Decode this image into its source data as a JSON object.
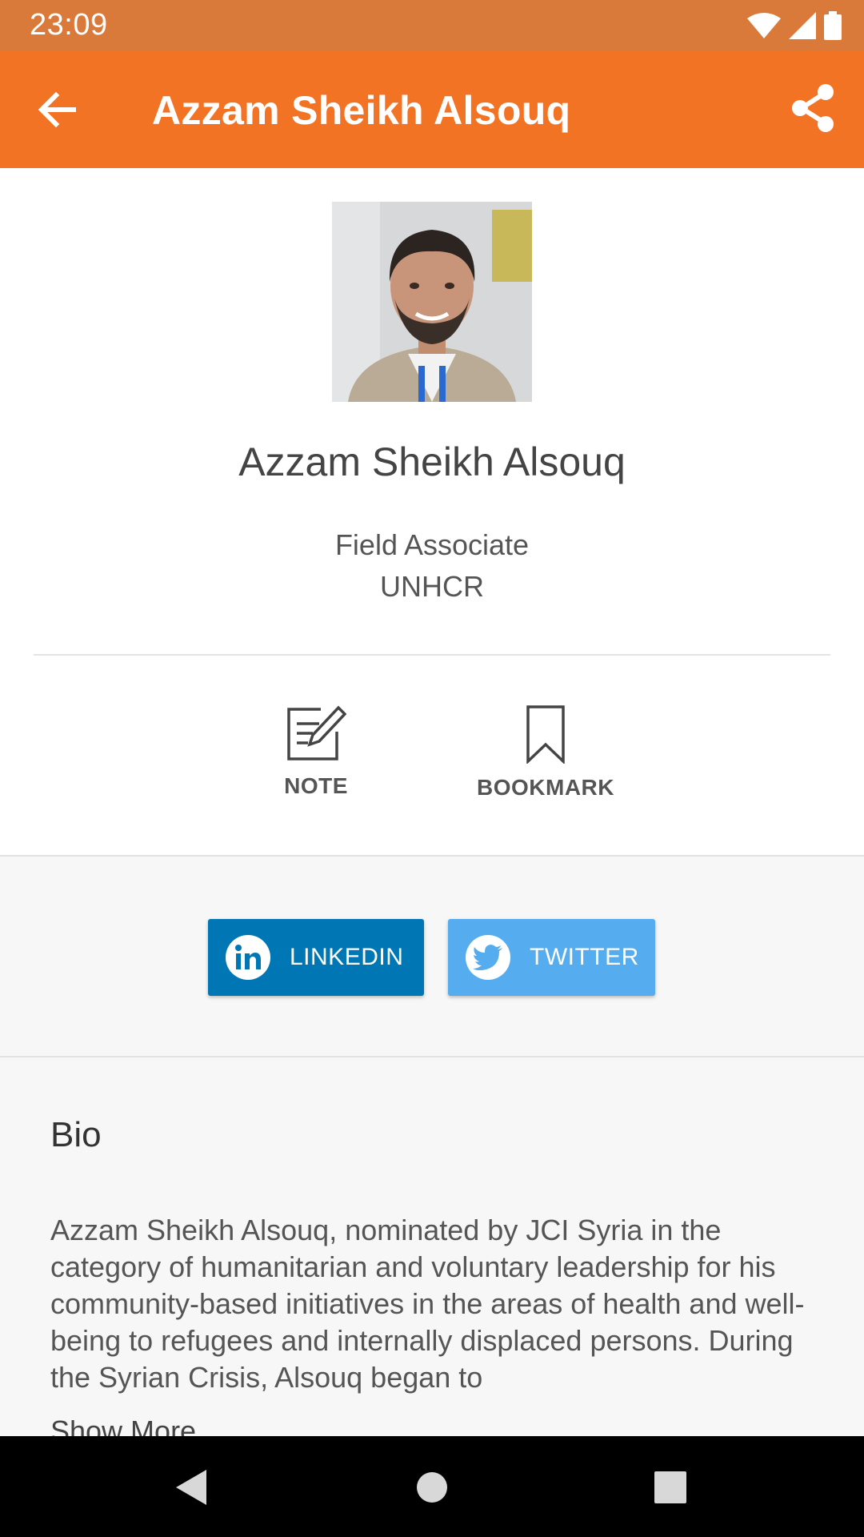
{
  "status_bar": {
    "time": "23:09"
  },
  "app_bar": {
    "title": "Azzam Sheikh Alsouq"
  },
  "profile": {
    "name": "Azzam Sheikh Alsouq",
    "job_title": "Field Associate",
    "organization": "UNHCR"
  },
  "actions": {
    "note_label": "NOTE",
    "bookmark_label": "BOOKMARK"
  },
  "social": {
    "linkedin_label": "LINKEDIN",
    "twitter_label": "TWITTER"
  },
  "bio": {
    "title": "Bio",
    "text": "Azzam Sheikh Alsouq, nominated by JCI Syria in the category of humanitarian and voluntary leadership for his community-based initiatives in the areas of health and well-being to refugees and internally displaced persons. During the Syrian Crisis, Alsouq began to",
    "show_more": "Show More"
  },
  "colors": {
    "status_bar": "#DA7A3A",
    "app_bar": "#F37325",
    "linkedin": "#0077B5",
    "twitter": "#55ACEE"
  },
  "icons": {
    "back": "arrow-left-icon",
    "share": "share-icon",
    "note": "edit-note-icon",
    "bookmark": "bookmark-icon",
    "linkedin": "linkedin-icon",
    "twitter": "twitter-bird-icon",
    "wifi": "wifi-icon",
    "signal": "cell-signal-icon",
    "battery": "battery-icon"
  }
}
